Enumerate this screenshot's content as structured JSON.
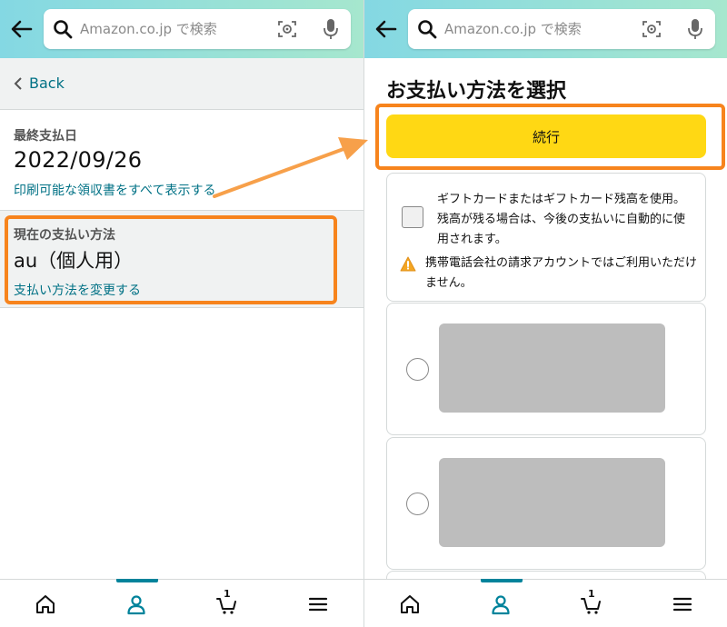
{
  "left": {
    "search": {
      "placeholder": "Amazon.co.jp で検索"
    },
    "back_label": "Back",
    "due": {
      "label": "最終支払日",
      "date": "2022/09/26",
      "receipt_link": "印刷可能な領収書をすべて表示する"
    },
    "payment": {
      "label": "現在の支払い方法",
      "value": "au（個人用）",
      "change_link": "支払い方法を変更する"
    }
  },
  "right": {
    "search": {
      "placeholder": "Amazon.co.jp で検索"
    },
    "title": "お支払い方法を選択",
    "continue_label": "続行",
    "gift_card_text": "ギフトカードまたはギフトカード残高を使用。 残高が残る場合は、今後の支払いに自動的に使用されます。",
    "warning_text": "携帯電話会社の請求アカウントではご利用いただけません。"
  },
  "bottom_nav": {
    "items": [
      "home-icon",
      "account-icon",
      "cart-icon",
      "menu-icon"
    ],
    "active": "account-icon",
    "cart_count": "1"
  },
  "colors": {
    "accent_teal": "#00839b",
    "link": "#007185",
    "continue_button": "#ffd814",
    "highlight_orange": "#f7841d",
    "header_gradient_start": "#84d8e3",
    "header_gradient_end": "#a6e7ce"
  }
}
